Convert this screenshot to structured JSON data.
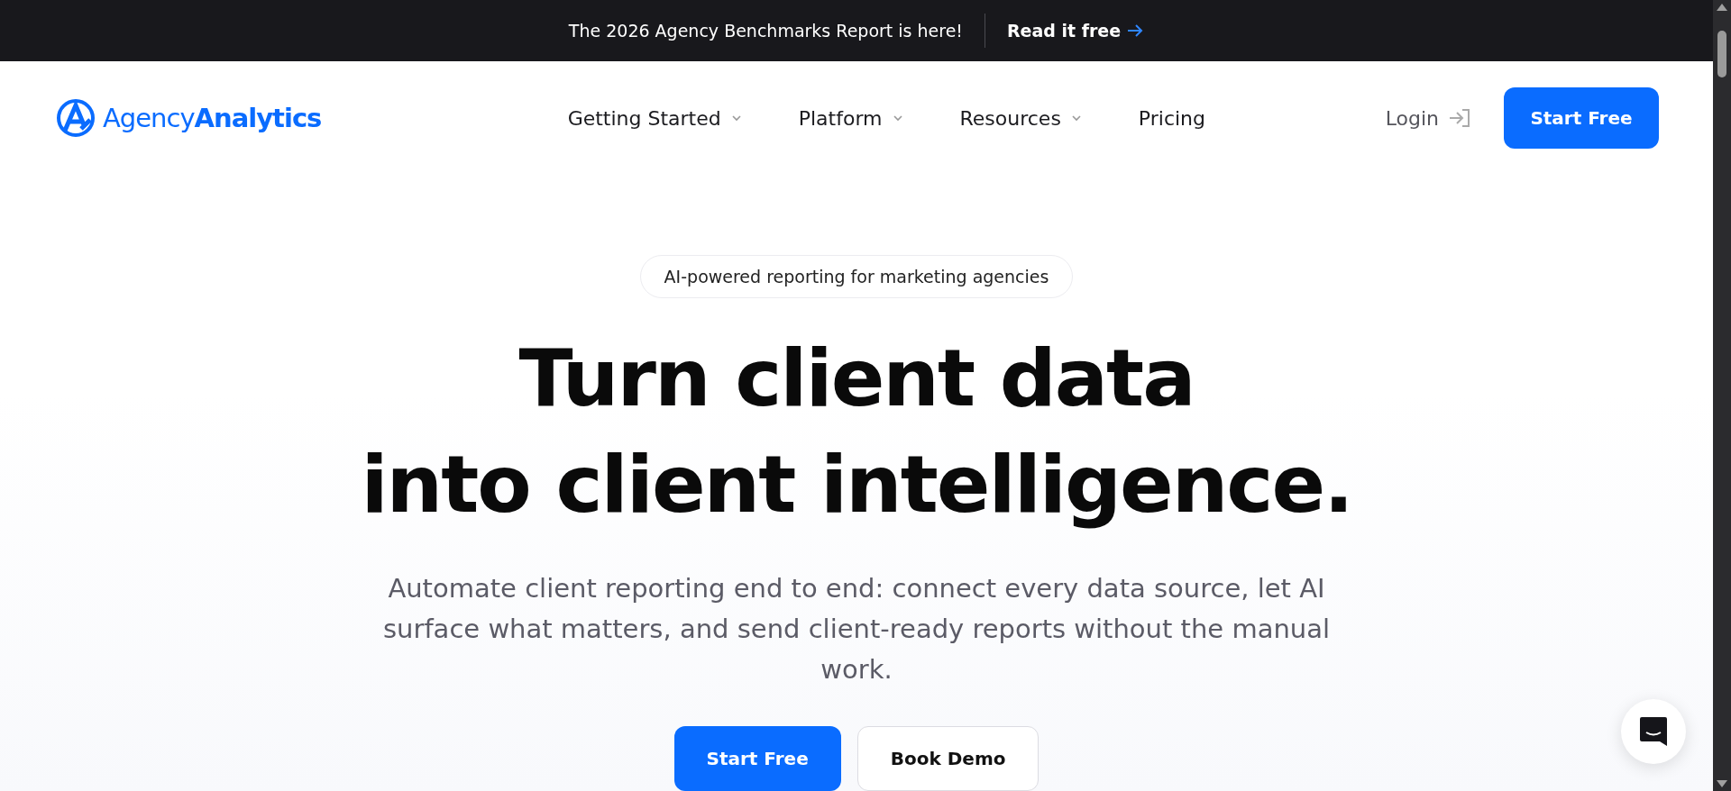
{
  "announcement": {
    "text": "The 2026 Agency Benchmarks Report is here!",
    "link": "Read it free"
  },
  "header": {
    "logo": "Agency**Analytics**",
    "nav": [
      {
        "label": "Getting Started",
        "dropdown": true
      },
      {
        "label": "Platform",
        "dropdown": true
      },
      {
        "label": "Resources",
        "dropdown": true
      },
      {
        "label": "Pricing",
        "dropdown": false
      }
    ],
    "login": "Login",
    "cta": "Start Free"
  },
  "hero": {
    "badge": "AI-powered reporting for marketing agencies",
    "headline": [
      "Turn client data",
      "into client intelligence."
    ],
    "description": "Automate client reporting end to end: connect every data source, let AI surface what matters, and send client-ready reports without the manual work.",
    "buttons": [
      {
        "label": "Start Free",
        "kind": "primary"
      },
      {
        "label": "Book Demo",
        "kind": "secondary"
      }
    ]
  }
}
